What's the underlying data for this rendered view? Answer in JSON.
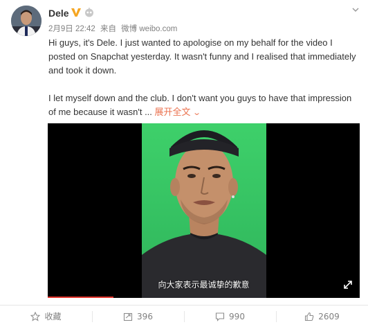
{
  "post": {
    "author": "Dele",
    "date": "2月9日 22:42",
    "source_prefix": "来自",
    "source": "微博 weibo.com",
    "paragraph1": "Hi guys, it's Dele. I just wanted to apologise on my behalf for the video I posted on Snapchat yesterday. It wasn't funny and I realised that immediately and took it down.",
    "paragraph2": "I let myself down and the club. I don't want you guys to have that impression of me because it wasn't",
    "ellipsis": " ...",
    "expand_label": "展开全文",
    "expand_chevron": "v"
  },
  "video": {
    "subtitle": "向大家表示最诚挚的歉意",
    "progress_fraction": 0.21
  },
  "actions": {
    "favorite_label": "收藏",
    "repost_count": "396",
    "comment_count": "990",
    "like_count": "2609"
  },
  "colors": {
    "accent": "#eb7350",
    "verified": "#f5a623",
    "green_screen": "#3ed06a"
  },
  "icons": {
    "verified": "verified-v-icon",
    "robot": "robot-icon",
    "dropdown": "chevron-down-icon",
    "favorite": "star-icon",
    "repost": "repost-icon",
    "comment": "comment-icon",
    "like": "thumbs-up-icon",
    "fullscreen": "fullscreen-icon"
  }
}
